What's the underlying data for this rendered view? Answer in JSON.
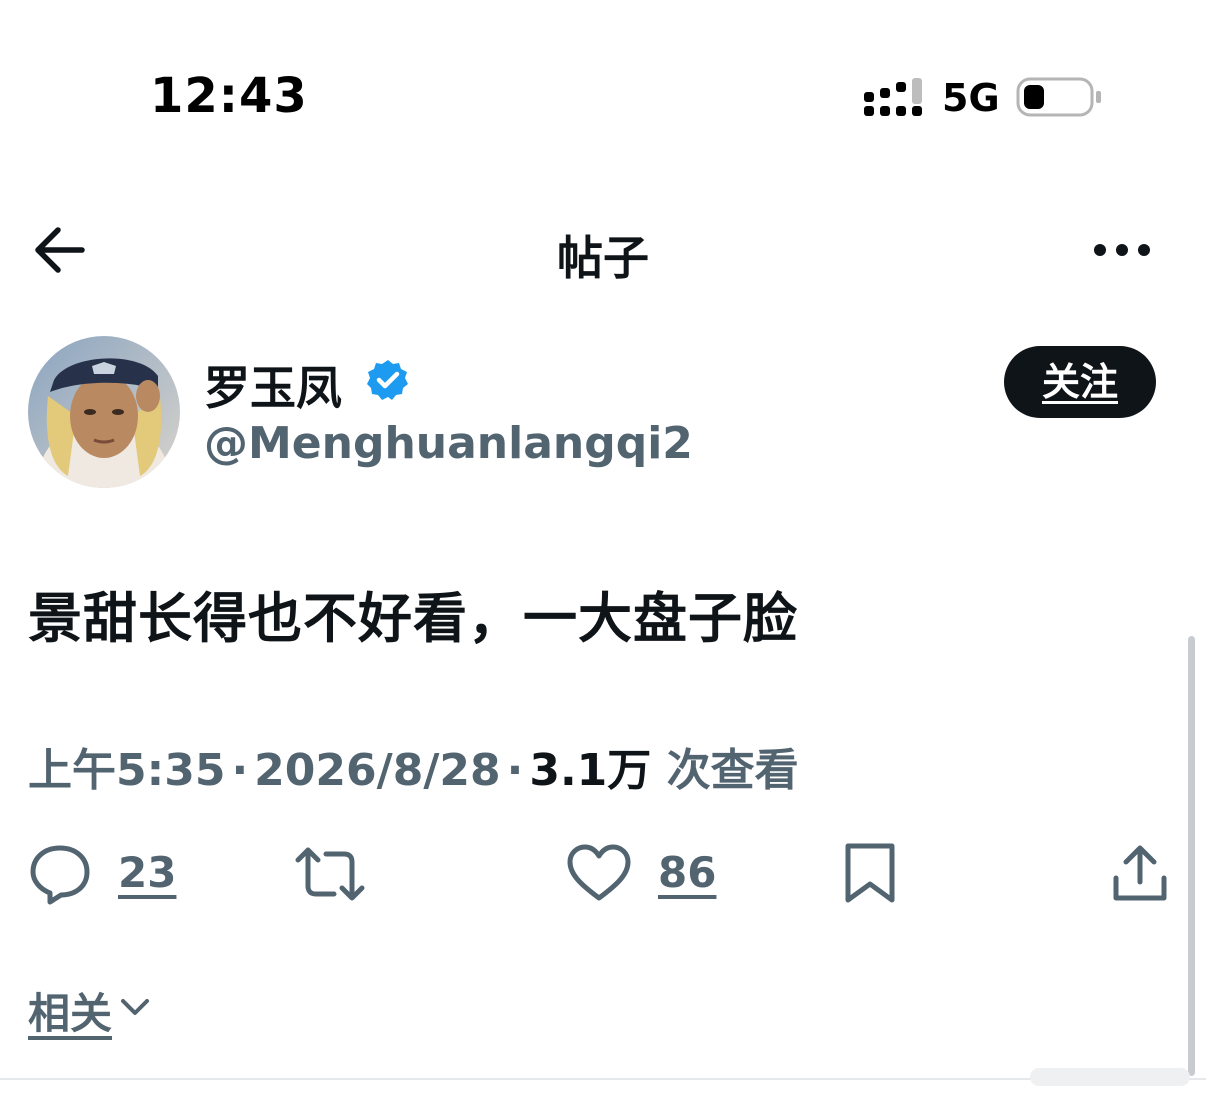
{
  "status_bar": {
    "time": "12:43",
    "network": "5G",
    "signal_icon": "cellular-signal-icon",
    "battery_icon": "battery-icon"
  },
  "nav": {
    "title": "帖子",
    "back_icon": "back-arrow-icon",
    "more_icon": "more-horizontal-icon"
  },
  "author": {
    "display_name": "罗玉凤",
    "username": "@Menghuanlangqi2",
    "verified": true,
    "follow_label": "关注"
  },
  "tweet": {
    "text": "景甜长得也不好看，一大盘子脸",
    "time": "上午5:35",
    "date": "2026/8/28",
    "views_count": "3.1万",
    "views_label": "次查看"
  },
  "actions": {
    "reply_count": "23",
    "like_count": "86"
  },
  "related": {
    "label": "相关"
  },
  "colors": {
    "primary_text": "#0f1419",
    "secondary_text": "#536471",
    "verified_blue": "#1d9bf0",
    "follow_bg": "#0f1419"
  }
}
